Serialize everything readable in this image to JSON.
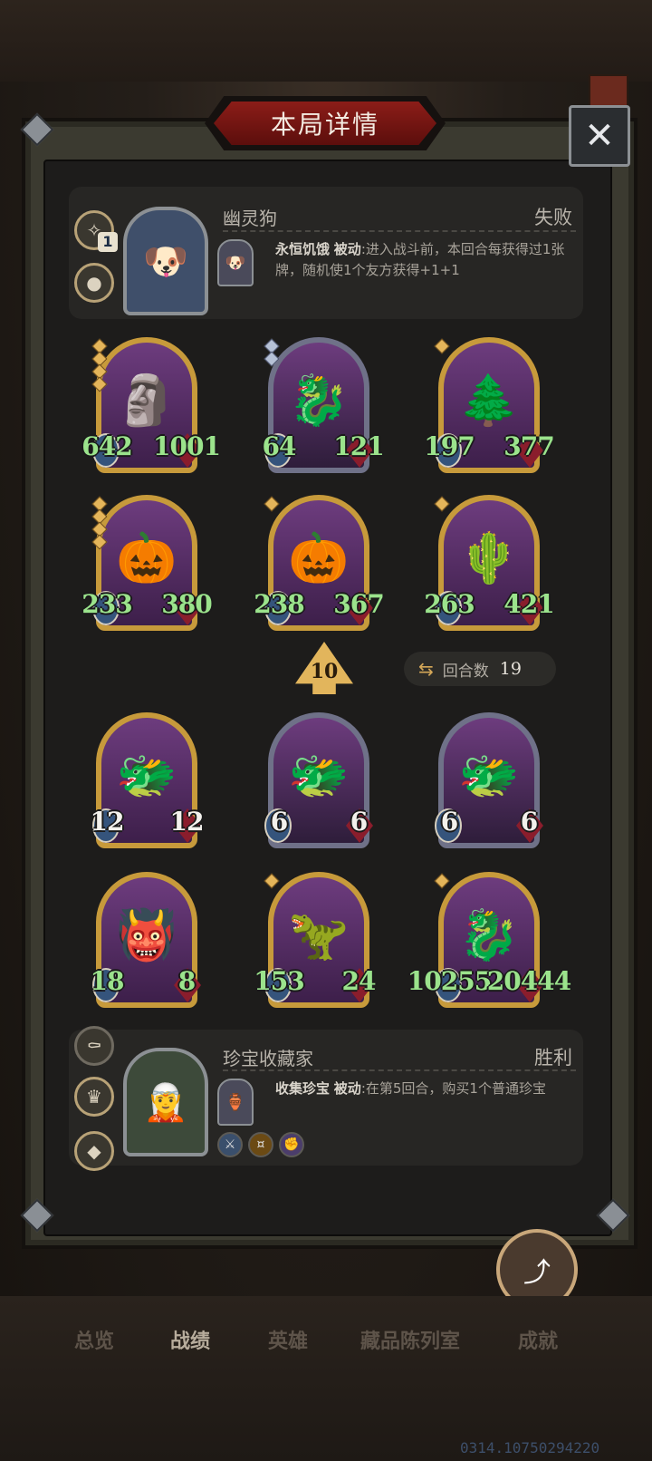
{
  "title": "本局详情",
  "close_label": "✕",
  "opponent": {
    "name": "幽灵狗",
    "result": "失败",
    "stack": "1",
    "skill_name": "永恒饥饿",
    "skill_type": "被动",
    "skill_text": ":进入战斗前，本回合每获得过1张牌，随机使1个友方获得+1+1"
  },
  "opponent_cards": [
    {
      "atk": "642",
      "hp": "1001",
      "frame": "gold",
      "stars": 4,
      "icon": "🗿"
    },
    {
      "atk": "64",
      "hp": "121",
      "frame": "silver",
      "stars": 2,
      "icon": "🐉"
    },
    {
      "atk": "197",
      "hp": "377",
      "frame": "gold",
      "stars": 1,
      "icon": "🌲"
    },
    {
      "atk": "233",
      "hp": "380",
      "frame": "gold",
      "stars": 4,
      "icon": "🎃"
    },
    {
      "atk": "238",
      "hp": "367",
      "frame": "gold",
      "stars": 1,
      "icon": "🎃"
    },
    {
      "atk": "263",
      "hp": "421",
      "frame": "gold",
      "stars": 1,
      "icon": "🌵"
    }
  ],
  "level": "10",
  "turns": {
    "label": "回合数",
    "value": "19"
  },
  "player_cards": [
    {
      "atk": "12",
      "hp": "12",
      "frame": "gold",
      "stars": 0,
      "icon": "🐲",
      "color": "white"
    },
    {
      "atk": "6",
      "hp": "6",
      "frame": "silver",
      "stars": 0,
      "icon": "🐲",
      "color": "white"
    },
    {
      "atk": "6",
      "hp": "6",
      "frame": "silver",
      "stars": 0,
      "icon": "🐲",
      "color": "white"
    },
    {
      "atk": "18",
      "hp": "8",
      "frame": "gold",
      "stars": 0,
      "icon": "👹",
      "color": "green"
    },
    {
      "atk": "153",
      "hp": "24",
      "frame": "gold",
      "stars": 1,
      "icon": "🦖",
      "color": "green"
    },
    {
      "atk": "10255",
      "hp": "20444",
      "frame": "gold",
      "stars": 1,
      "icon": "🐉",
      "color": "green"
    }
  ],
  "player": {
    "name": "珍宝收藏家",
    "result": "胜利",
    "skill_name": "收集珍宝",
    "skill_type": "被动",
    "skill_text": ":在第5回合，购买1个普通珍宝"
  },
  "share_label": "分享",
  "nav": [
    "总览",
    "战绩",
    "英雄",
    "藏品陈列室",
    "成就"
  ],
  "watermark": "0314.10750294220"
}
